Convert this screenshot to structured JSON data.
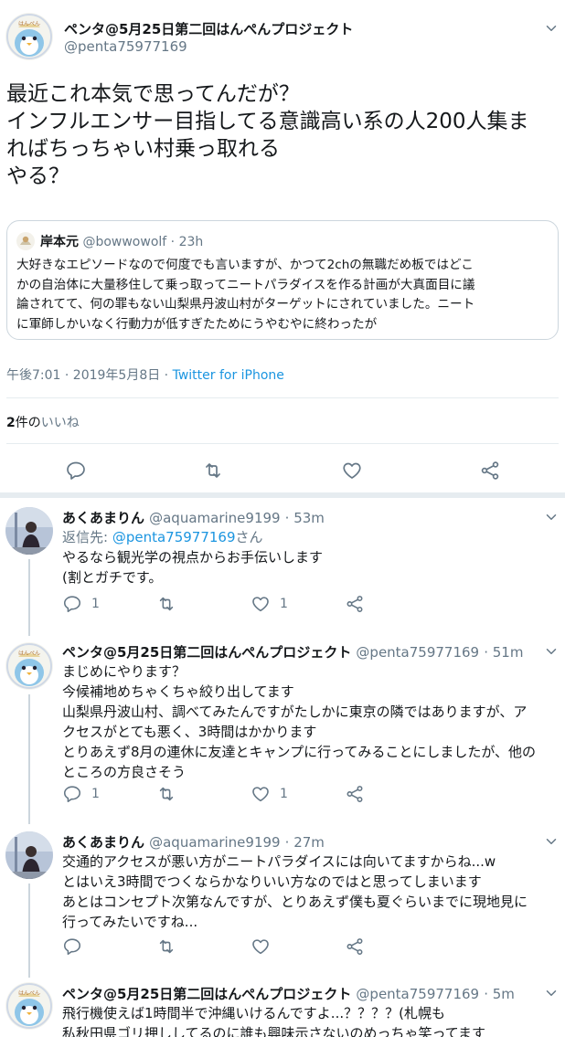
{
  "main_tweet": {
    "display_name": "ペンタ@5月25日第二回はんぺんプロジェクト",
    "handle": "@penta75977169",
    "lines": [
      "最近これ本気で思ってんだが？",
      "インフルエンサー目指してる意識高い系の人200人集ま",
      "ればちっちゃい村乗っ取れる",
      "やる？"
    ],
    "quote": {
      "display_name": "岸本元",
      "handle": "@bowwowolf",
      "time": "· 23h",
      "lines": [
        "大好きなエピソードなので何度でも言いますが、かつて2chの無職だめ板ではどこ",
        "かの自治体に大量移住して乗っ取ってニートパラダイスを作る計画が大真面目に議",
        "論されてて、何の罪もない山梨県丹波山村がターゲットにされていました。ニート",
        "に軍師しかいなく行動力が低すぎたためにうやむやに終わったが"
      ]
    },
    "timestamp": "午後7:01 · 2019年5月8日 · ",
    "source": "Twitter for iPhone",
    "likes_count": "2",
    "likes_mid": "件の",
    "likes_label": "いいね"
  },
  "replies": [
    {
      "display_name": "あくあまりん",
      "handle": "@aquamarine9199",
      "time": "· 53m",
      "reply_to_prefix": "返信先: ",
      "reply_to_handle": "@penta75977169",
      "reply_to_suffix": "さん",
      "lines": [
        "やるなら観光学の視点からお手伝いします",
        "(割とガチです。"
      ],
      "reply_count": "1",
      "retweet_count": "",
      "like_count": "1"
    },
    {
      "display_name": "ペンタ@5月25日第二回はんぺんプロジェクト",
      "handle": "@penta75977169",
      "time": "· 51m",
      "lines": [
        "まじめにやります？",
        "今候補地めちゃくちゃ絞り出してます",
        "山梨県丹波山村、調べてみたんですがたしかに東京の隣ではありますが、ア",
        "クセスがとても悪く、3時間はかかります",
        "とりあえず8月の連休に友達とキャンプに行ってみることにしましたが、他の",
        "ところの方良さそう"
      ],
      "reply_count": "1",
      "retweet_count": "",
      "like_count": "1"
    },
    {
      "display_name": "あくあまりん",
      "handle": "@aquamarine9199",
      "time": "· 27m",
      "lines": [
        "交通的アクセスが悪い方がニートパラダイスには向いてますからね...w",
        "とはいえ3時間でつくならかなりいい方なのではと思ってしまいます",
        "あとはコンセプト次第なんですが、とりあえず僕も夏ぐらいまでに現地見に",
        "行ってみたいですね..."
      ],
      "reply_count": "",
      "retweet_count": "",
      "like_count": ""
    },
    {
      "display_name": "ペンタ@5月25日第二回はんぺんプロジェクト",
      "handle": "@penta75977169",
      "time": "· 5m",
      "lines": [
        "飛行機使えば1時間半で沖縄いけるんですよ...？？？？(札幌も",
        "私秋田県ゴリ押ししてるのに誰も興味示さないのめっちゃ笑ってます"
      ]
    }
  ],
  "icons": {
    "chevron": "chevron-down-icon",
    "reply": "reply-icon",
    "retweet": "retweet-icon",
    "like": "heart-icon",
    "share": "share-icon"
  },
  "colors": {
    "link": "#1b95e0",
    "muted": "#657786",
    "border": "#e6ecf0"
  }
}
